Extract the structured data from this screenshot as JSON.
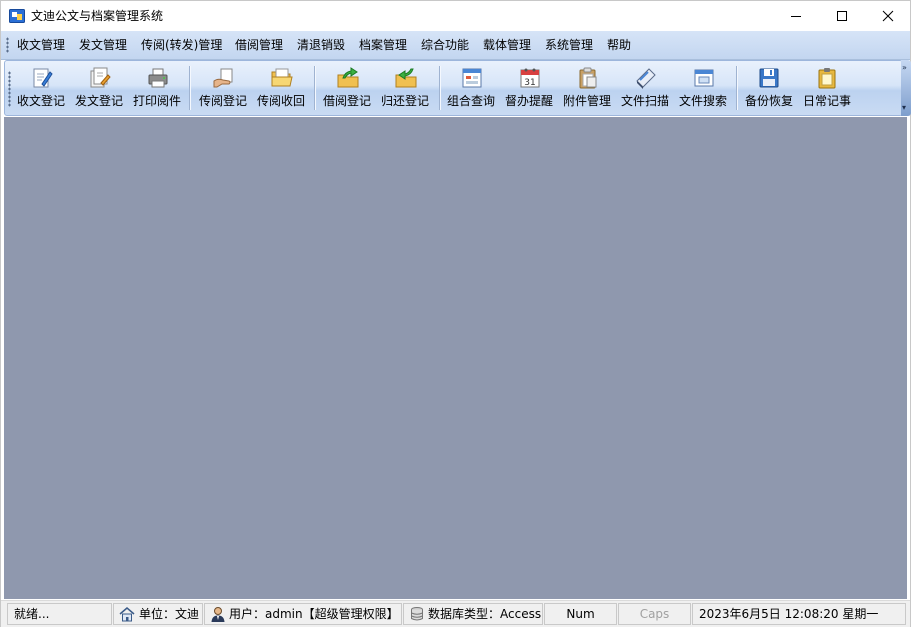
{
  "window": {
    "title": "文迪公文与档案管理系统",
    "controls": {
      "minimize": "minimize",
      "maximize": "maximize",
      "close": "close"
    }
  },
  "menubar": {
    "items": [
      {
        "label": "收文管理"
      },
      {
        "label": "发文管理"
      },
      {
        "label": "传阅(转发)管理"
      },
      {
        "label": "借阅管理"
      },
      {
        "label": "清退销毁"
      },
      {
        "label": "档案管理"
      },
      {
        "label": "综合功能"
      },
      {
        "label": "载体管理"
      },
      {
        "label": "系统管理"
      },
      {
        "label": "帮助"
      }
    ]
  },
  "toolbar": {
    "items": [
      {
        "label": "收文登记",
        "icon": "edit-document-icon"
      },
      {
        "label": "发文登记",
        "icon": "document-pen-icon"
      },
      {
        "label": "打印阅件",
        "icon": "printer-icon"
      },
      {
        "label": "传阅登记",
        "icon": "hand-document-icon"
      },
      {
        "label": "传阅收回",
        "icon": "folder-open-icon"
      },
      {
        "label": "借阅登记",
        "icon": "folder-arrow-up-icon"
      },
      {
        "label": "归还登记",
        "icon": "folder-arrow-back-icon"
      },
      {
        "label": "组合查询",
        "icon": "form-window-icon"
      },
      {
        "label": "督办提醒",
        "icon": "calendar-icon"
      },
      {
        "label": "附件管理",
        "icon": "clipboard-icon"
      },
      {
        "label": "文件扫描",
        "icon": "scanner-icon"
      },
      {
        "label": "文件搜索",
        "icon": "search-window-icon"
      },
      {
        "label": "备份恢复",
        "icon": "floppy-disk-icon"
      },
      {
        "label": "日常记事",
        "icon": "notepad-icon"
      }
    ],
    "calendar_day": "31"
  },
  "statusbar": {
    "ready": "就绪...",
    "unit": "单位：文迪",
    "user": "用户：admin【超级管理权限】",
    "database": "数据库类型：Access",
    "num": "Num",
    "caps": "Caps",
    "datetime": "2023年6月5日 12:08:20 星期一"
  },
  "colors": {
    "client_background": "#8f98ae",
    "menubar": "#c9daf2",
    "toolbar": "#d0e0f6"
  }
}
